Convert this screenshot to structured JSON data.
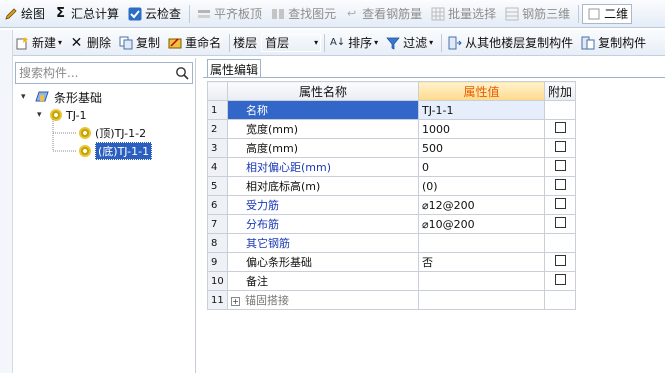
{
  "toolbar1": {
    "items": [
      {
        "label": "绘图",
        "icon": "pencil-icon",
        "disabled": false
      },
      {
        "label": "汇总计算",
        "icon": "sigma-icon",
        "disabled": false
      },
      {
        "label": "云检查",
        "icon": "check-icon",
        "disabled": false
      },
      {
        "label": "平齐板顶",
        "icon": "level-icon",
        "disabled": true
      },
      {
        "label": "查找图元",
        "icon": "find-icon",
        "disabled": true
      },
      {
        "label": "查看钢筋量",
        "icon": "rebar-view-icon",
        "disabled": true
      },
      {
        "label": "批量选择",
        "icon": "batch-select-icon",
        "disabled": true
      },
      {
        "label": "钢筋三维",
        "icon": "rebar-3d-icon",
        "disabled": true
      }
    ],
    "view_dropdown": "二维"
  },
  "toolbar2": {
    "new_label": "新建",
    "delete_label": "删除",
    "copy_label": "复制",
    "rename_label": "重命名",
    "floor_label": "楼层",
    "floor_value": "首层",
    "sort_label": "排序",
    "filter_label": "过滤",
    "copy_from_floor_label": "从其他楼层复制构件",
    "copy_to_label": "复制构件"
  },
  "tree": {
    "search_placeholder": "搜索构件...",
    "root_label": "条形基础",
    "group_label": "TJ-1",
    "child1_label": "(顶)TJ-1-2",
    "child2_label": "(底)TJ-1-1"
  },
  "props": {
    "tab_label": "属性编辑",
    "col_name": "属性名称",
    "col_value": "属性值",
    "col_extra": "附加",
    "rows": [
      {
        "num": "1",
        "name": "名称",
        "value": "TJ-1-1"
      },
      {
        "num": "2",
        "name": "宽度(mm)",
        "value": "1000"
      },
      {
        "num": "3",
        "name": "高度(mm)",
        "value": "500"
      },
      {
        "num": "4",
        "name": "相对偏心距(mm)",
        "value": "0"
      },
      {
        "num": "5",
        "name": "相对底标高(m)",
        "value": "(0)"
      },
      {
        "num": "6",
        "name": "受力筋",
        "value": "⌀12@200"
      },
      {
        "num": "7",
        "name": "分布筋",
        "value": "⌀10@200"
      },
      {
        "num": "8",
        "name": "其它钢筋",
        "value": ""
      },
      {
        "num": "9",
        "name": "偏心条形基础",
        "value": "否"
      },
      {
        "num": "10",
        "name": "备注",
        "value": ""
      },
      {
        "num": "11",
        "name": "锚固搭接",
        "value": ""
      }
    ]
  },
  "colors": {
    "accent": "#2a5fc0",
    "blue_text": "#1a39b7",
    "header_value": "#e65c00"
  }
}
